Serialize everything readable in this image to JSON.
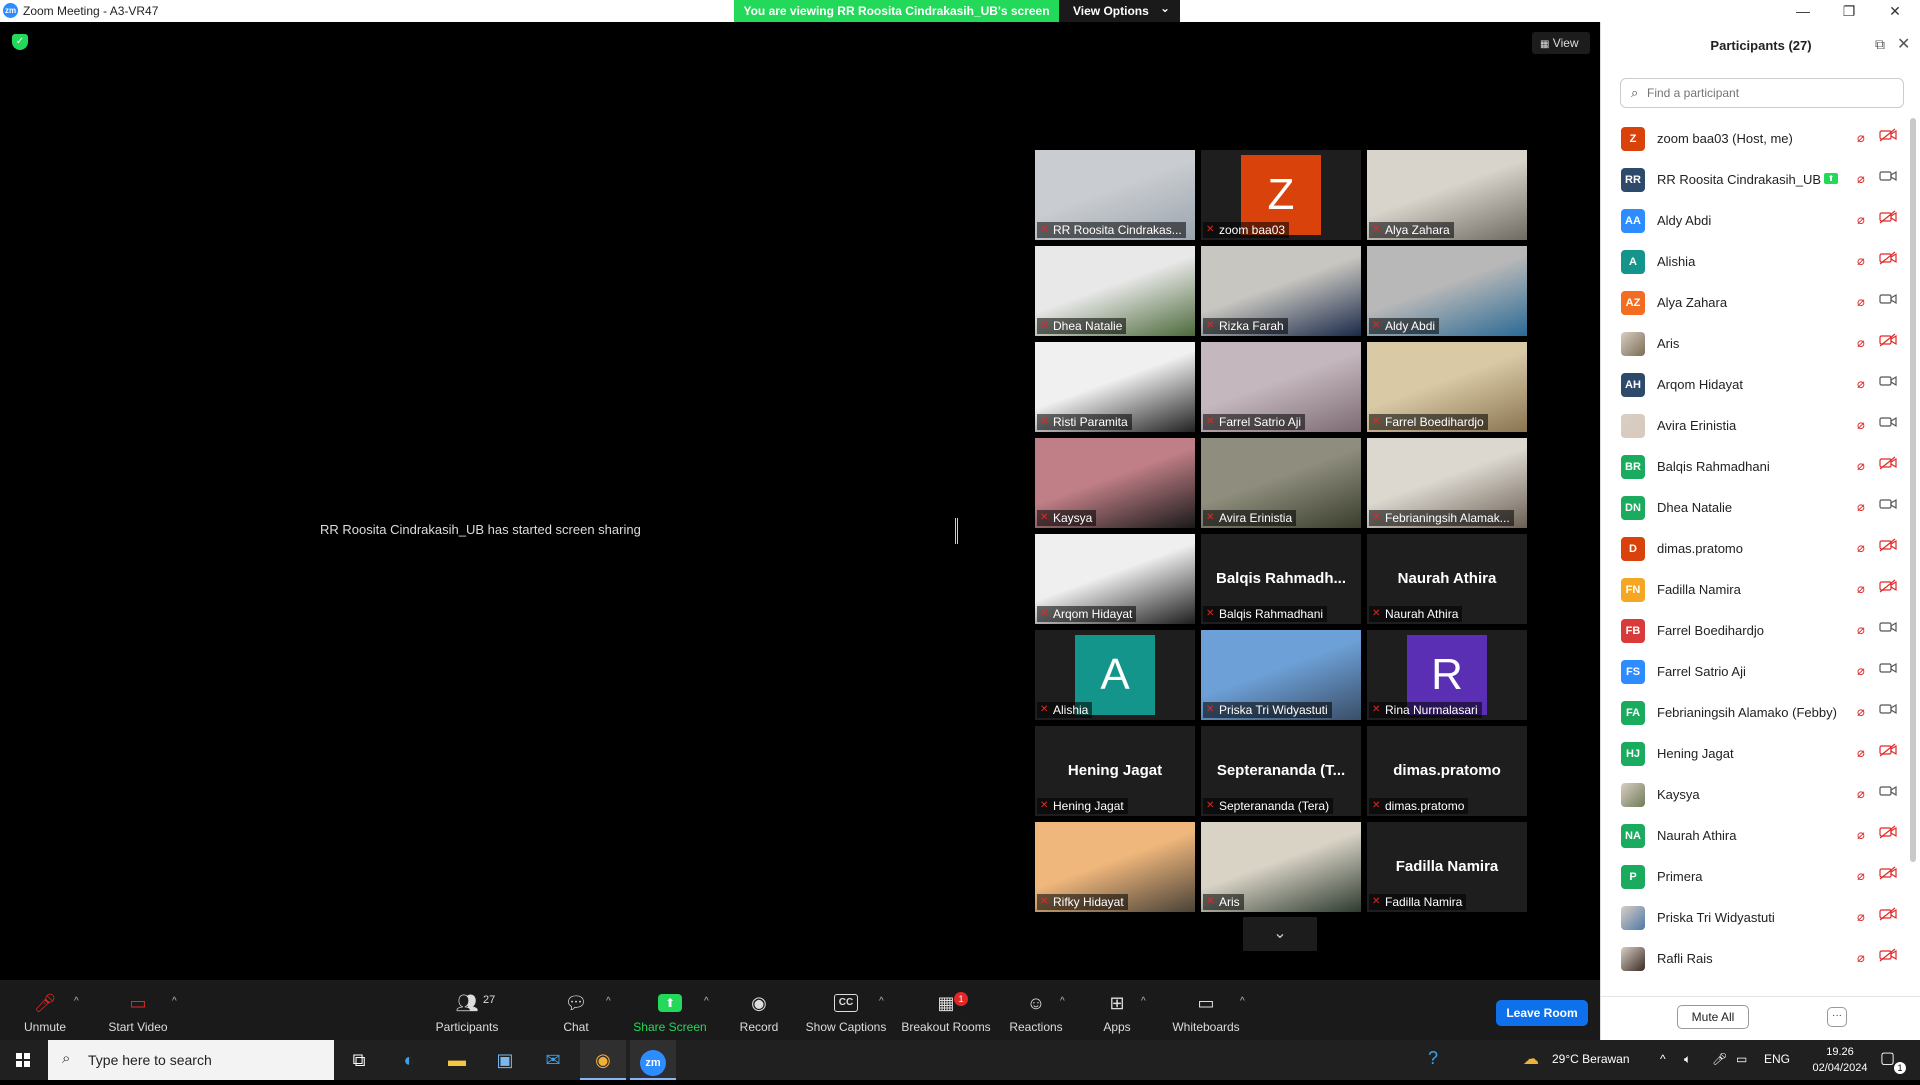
{
  "window": {
    "app_icon_label": "zm",
    "title": "Zoom Meeting - A3-VR47",
    "minimize_glyph": "—",
    "maximize_glyph": "❐",
    "close_glyph": "✕"
  },
  "share_banner": {
    "message": "You are viewing RR Roosita Cindrakasih_UB's screen",
    "view_options": "View Options",
    "caret": "⌄"
  },
  "stage": {
    "view_label": "View",
    "sharing_message": "RR Roosita Cindrakasih_UB has started screen sharing"
  },
  "gallery": [
    {
      "name": "RR Roosita Cindrakas...",
      "type": "video",
      "colors": [
        "#c9ccd0",
        "#9aa4ae"
      ]
    },
    {
      "name": "zoom baa03",
      "type": "avatar",
      "letter": "Z",
      "color": "#d9420b"
    },
    {
      "name": "Alya Zahara",
      "type": "video",
      "colors": [
        "#d8d4cc",
        "#6e6a62"
      ]
    },
    {
      "name": "Dhea Natalie",
      "type": "video",
      "colors": [
        "#e8e8e8",
        "#4d6a3b"
      ]
    },
    {
      "name": "Rizka Farah",
      "type": "video",
      "colors": [
        "#c8c6c0",
        "#1b2a4a"
      ]
    },
    {
      "name": "Aldy Abdi",
      "type": "video",
      "colors": [
        "#b8b8b8",
        "#2b6a95"
      ]
    },
    {
      "name": "Risti Paramita",
      "type": "video",
      "colors": [
        "#f0f0f0",
        "#222222"
      ]
    },
    {
      "name": "Farrel Satrio Aji",
      "type": "video",
      "colors": [
        "#c4b7bd",
        "#7e6b74"
      ]
    },
    {
      "name": "Farrel Boedihardjo",
      "type": "video",
      "colors": [
        "#d9c9a5",
        "#8a7452"
      ]
    },
    {
      "name": "Kaysya",
      "type": "video",
      "colors": [
        "#c07f86",
        "#1a1a1a"
      ]
    },
    {
      "name": "Avira Erinistia",
      "type": "video",
      "colors": [
        "#8f8e7e",
        "#3a3d2c"
      ]
    },
    {
      "name": "Febrianingsih Alamak...",
      "type": "video",
      "colors": [
        "#dcd8d0",
        "#6b5f54"
      ]
    },
    {
      "name": "Arqom Hidayat",
      "type": "video",
      "colors": [
        "#efefef",
        "#1e1e1e"
      ]
    },
    {
      "name": "Balqis Rahmadhani",
      "type": "name",
      "title": "Balqis  Rahmadh..."
    },
    {
      "name": "Naurah Athira",
      "type": "name",
      "title": "Naurah Athira"
    },
    {
      "name": "Alishia",
      "type": "avatar",
      "letter": "A",
      "color": "#13958b"
    },
    {
      "name": "Priska Tri Widyastuti",
      "type": "video",
      "colors": [
        "#6da0d6",
        "#3a4e68"
      ],
      "active": true
    },
    {
      "name": "Rina Nurmalasari",
      "type": "avatar",
      "letter": "R",
      "color": "#5a2fb3"
    },
    {
      "name": "Hening Jagat",
      "type": "name",
      "title": "Hening Jagat"
    },
    {
      "name": "Septerananda (Tera)",
      "type": "name",
      "title": "Septerananda  (T..."
    },
    {
      "name": "dimas.pratomo",
      "type": "name",
      "title": "dimas.pratomo"
    },
    {
      "name": "Rifky Hidayat",
      "type": "video",
      "colors": [
        "#f0b77c",
        "#4a4238"
      ]
    },
    {
      "name": "Aris",
      "type": "video",
      "colors": [
        "#d9d3c6",
        "#2e3b30"
      ]
    },
    {
      "name": "Fadilla Namira",
      "type": "name",
      "title": "Fadilla Namira"
    }
  ],
  "toolbar": {
    "unmute": "Unmute",
    "start_video": "Start Video",
    "participants": "Participants",
    "participants_count": "27",
    "chat": "Chat",
    "share_screen": "Share Screen",
    "record": "Record",
    "show_captions": "Show Captions",
    "breakout_rooms": "Breakout Rooms",
    "breakout_badge": "1",
    "reactions": "Reactions",
    "apps": "Apps",
    "whiteboards": "Whiteboards",
    "leave_room": "Leave Room"
  },
  "panel": {
    "title": "Participants (27)",
    "search_placeholder": "Find a participant",
    "mute_all": "Mute All",
    "more": "···",
    "participants": [
      {
        "name": "zoom baa03 (Host, me)",
        "initials": "Z",
        "color": "#d9420b",
        "video": "off"
      },
      {
        "name": "RR Roosita Cindrakasih_UB",
        "initials": "RR",
        "color": "#2e4a6b",
        "video": "on",
        "sharing": true
      },
      {
        "name": "Aldy Abdi",
        "initials": "AA",
        "color": "#2d8cff",
        "video": "off"
      },
      {
        "name": "Alishia",
        "initials": "A",
        "color": "#13958b",
        "video": "off"
      },
      {
        "name": "Alya Zahara",
        "initials": "AZ",
        "color": "#f26d21",
        "video": "on"
      },
      {
        "name": "Aris",
        "initials": "",
        "color": "#7a6c55",
        "video": "off",
        "photo": true
      },
      {
        "name": "Arqom Hidayat",
        "initials": "AH",
        "color": "#2e4a6b",
        "video": "on"
      },
      {
        "name": "Avira Erinistia",
        "initials": "",
        "color": "#d8c9bc",
        "video": "on",
        "photo": true
      },
      {
        "name": "Balqis Rahmadhani",
        "initials": "BR",
        "color": "#1aab5f",
        "video": "off"
      },
      {
        "name": "Dhea Natalie",
        "initials": "DN",
        "color": "#1aab5f",
        "video": "on"
      },
      {
        "name": "dimas.pratomo",
        "initials": "D",
        "color": "#d9420b",
        "video": "off"
      },
      {
        "name": "Fadilla Namira",
        "initials": "FN",
        "color": "#f5a623",
        "video": "off"
      },
      {
        "name": "Farrel Boedihardjo",
        "initials": "FB",
        "color": "#d93a3a",
        "video": "on"
      },
      {
        "name": "Farrel Satrio Aji",
        "initials": "FS",
        "color": "#2d8cff",
        "video": "on"
      },
      {
        "name": "Febrianingsih Alamako (Febby)",
        "initials": "FA",
        "color": "#1aab5f",
        "video": "on"
      },
      {
        "name": "Hening Jagat",
        "initials": "HJ",
        "color": "#1aab5f",
        "video": "off"
      },
      {
        "name": "Kaysya",
        "initials": "",
        "color": "#6f7b58",
        "video": "on",
        "photo": true
      },
      {
        "name": "Naurah Athira",
        "initials": "NA",
        "color": "#1aab5f",
        "video": "off"
      },
      {
        "name": "Primera",
        "initials": "P",
        "color": "#1aab5f",
        "video": "off"
      },
      {
        "name": "Priska Tri Widyastuti",
        "initials": "",
        "color": "#4f78a8",
        "video": "off",
        "photo": true
      },
      {
        "name": "Rafli Rais",
        "initials": "",
        "color": "#3b2a22",
        "video": "off",
        "photo": true
      }
    ]
  },
  "taskbar": {
    "search_placeholder": "Type here to search",
    "weather": "29°C  Berawan",
    "language": "ENG",
    "time": "19.26",
    "date": "02/04/2024",
    "notification_count": "1"
  }
}
